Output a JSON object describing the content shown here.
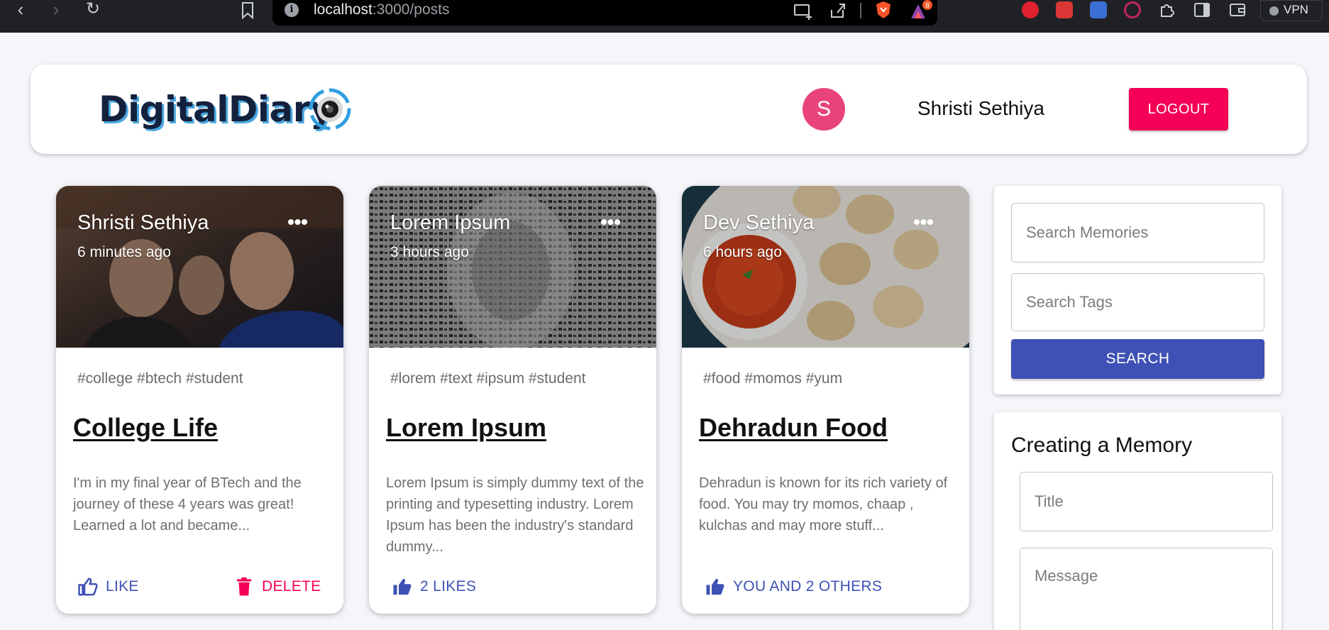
{
  "browser": {
    "url_host": "localhost",
    "url_path": ":3000/posts",
    "notification_count": "8",
    "vpn_label": "VPN"
  },
  "header": {
    "brand": "DigitalDiary",
    "avatar_initial": "S",
    "user_name": "Shristi Sethiya",
    "logout_label": "LOGOUT"
  },
  "posts": [
    {
      "author": "Shristi Sethiya",
      "time": "6 minutes ago",
      "tags": "#college #btech #student",
      "title": "College Life",
      "message": "I'm in my final year of BTech and the journey of these 4 years was great! Learned a lot and became...",
      "like_label": "LIKE",
      "delete_label": "DELETE"
    },
    {
      "author": "Lorem Ipsum",
      "time": "3 hours ago",
      "tags": "#lorem #text #ipsum #student",
      "title": "Lorem Ipsum",
      "message": "Lorem Ipsum is simply dummy text of the printing and typesetting industry. Lorem Ipsum has been the industry's standard dummy...",
      "like_label": "2 LIKES"
    },
    {
      "author": "Dev Sethiya",
      "time": "6 hours ago",
      "tags": "#food #momos #yum",
      "title": "Dehradun Food",
      "message": "Dehradun is known for its rich variety of food. You may try momos, chaap , kulchas and may more stuff...",
      "like_label": "YOU AND 2 OTHERS"
    }
  ],
  "search": {
    "memories_placeholder": "Search Memories",
    "tags_placeholder": "Search Tags",
    "button_label": "SEARCH"
  },
  "create": {
    "heading": "Creating a Memory",
    "title_placeholder": "Title",
    "message_placeholder": "Message"
  },
  "colors": {
    "primary": "#3f51b5",
    "secondary": "#f50057",
    "avatar": "#e8437a"
  }
}
